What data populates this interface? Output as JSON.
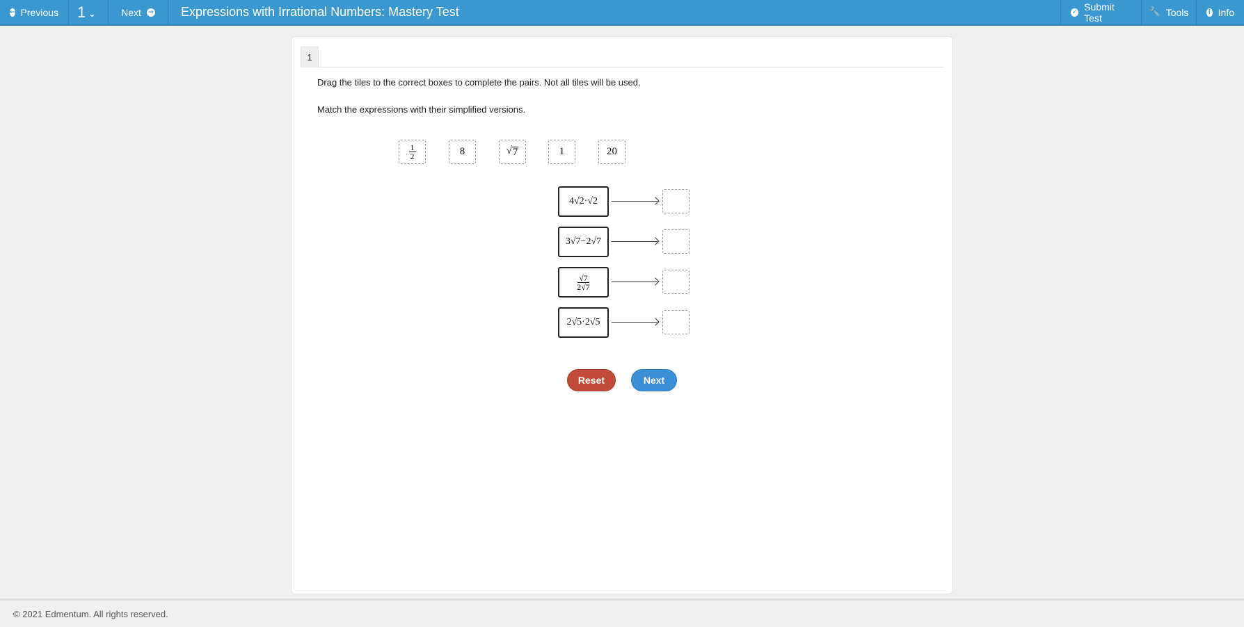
{
  "topbar": {
    "previous_label": "Previous",
    "question_number": "1",
    "next_label": "Next",
    "title": "Expressions with Irrational Numbers: Mastery Test",
    "submit_label": "Submit Test",
    "tools_label": "Tools",
    "info_label": "Info"
  },
  "question": {
    "tab_label": "1",
    "instruction": "Drag the tiles to the correct boxes to complete the pairs. Not all tiles will be used.",
    "prompt": "Match the expressions with their simplified versions."
  },
  "tiles": [
    {
      "kind": "fraction",
      "numerator": "1",
      "denominator": "2"
    },
    {
      "kind": "text",
      "text": "8"
    },
    {
      "kind": "radical",
      "text": "7"
    },
    {
      "kind": "text",
      "text": "1"
    },
    {
      "kind": "text",
      "text": "20"
    }
  ],
  "pairs": [
    {
      "expression": "4√2·√2"
    },
    {
      "expression": "3√7−2√7"
    },
    {
      "expression_numerator": "√7",
      "expression_denominator": "2√7"
    },
    {
      "expression": "2√5·2√5"
    }
  ],
  "buttons": {
    "reset_label": "Reset",
    "next_label": "Next"
  },
  "footer": {
    "copyright": "© 2021 Edmentum. All rights reserved."
  },
  "colors": {
    "topbar": "#3a97cf",
    "reset": "#c24a3a",
    "next": "#3a8fd6"
  }
}
